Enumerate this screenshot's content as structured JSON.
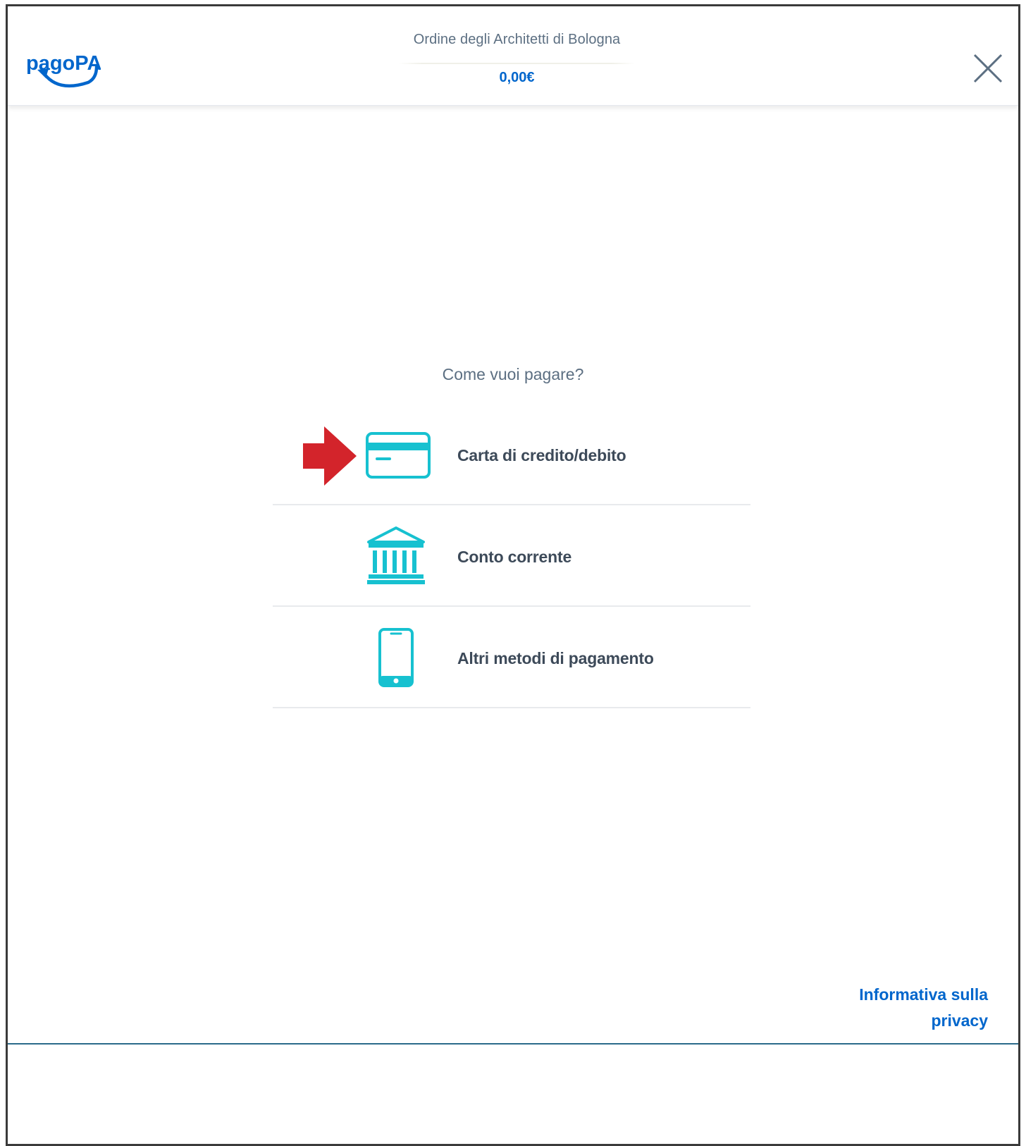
{
  "header": {
    "logo_text": "pagoPA",
    "organization": "Ordine degli Architetti di Bologna",
    "amount": "0,00€",
    "close_icon": "close-icon"
  },
  "main": {
    "prompt": "Come vuoi pagare?",
    "methods": [
      {
        "label": "Carta di credito/debito",
        "icon": "credit-card-icon",
        "highlighted": true
      },
      {
        "label": "Conto corrente",
        "icon": "bank-icon"
      },
      {
        "label": "Altri metodi di pagamento",
        "icon": "smartphone-icon"
      }
    ]
  },
  "footer": {
    "privacy_line1": "Informativa sulla",
    "privacy_line2": "privacy"
  },
  "colors": {
    "accent": "#0066cc",
    "icon_teal": "#17c1d0",
    "arrow_red": "#d3242b",
    "text": "#5c6f82"
  }
}
